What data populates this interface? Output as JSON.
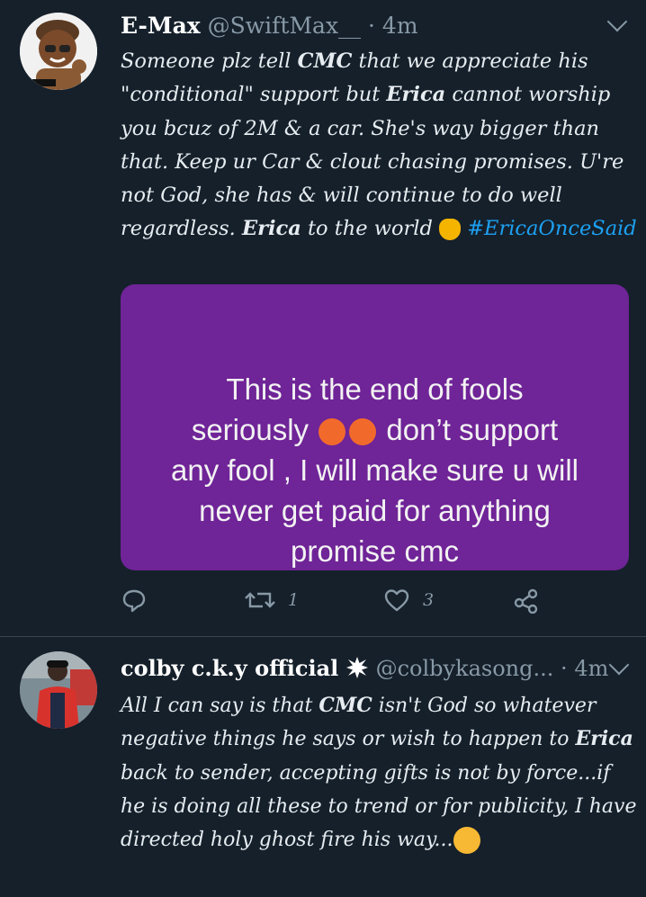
{
  "tweets": [
    {
      "display_name": "E-Max",
      "handle": "@SwiftMax__",
      "separator": "·",
      "time": "4m",
      "body": {
        "p1": "Someone plz tell ",
        "b1": "CMC",
        "p2": " that we appreciate his \"conditional\" support but ",
        "b2": "Erica",
        "p3": " cannot worship you bcuz of 2M & a car. She's way bigger than that. Keep ur Car & clout chasing promises. U're not God, she has & will continue to do well regardless. ",
        "b3": "Erica",
        "p4": " to the world ",
        "hashtag": "#EricaOnceSaid"
      },
      "media_text": {
        "line1": "This is the end of fools",
        "line2a": "seriously",
        "line2b": "don’t support",
        "line3": "any fool , I will make sure u will",
        "line4": "never get paid for anything",
        "line5": "promise cmc"
      },
      "actions": {
        "reply_count": "",
        "retweet_count": "1",
        "like_count": "3"
      }
    },
    {
      "display_name": "colby c.k.y official",
      "handle": "@colbykasong...",
      "separator": "·",
      "time": "4m",
      "body": {
        "p1": "All I can say is that ",
        "b1": "CMC",
        "p2": " isn't God so whatever negative things he says or wish to happen to ",
        "b2": "Erica",
        "p3": " back to sender, accepting gifts is not by force...if he is doing all these to trend or for publicity, I have directed holy ghost fire his way..."
      }
    }
  ],
  "colors": {
    "background": "#15202b",
    "link": "#1da1f2",
    "muted": "#8899a6",
    "media_bg": "#6f2497"
  },
  "icons": [
    "reply-icon",
    "retweet-icon",
    "like-icon",
    "share-icon",
    "chevron-down-icon"
  ]
}
